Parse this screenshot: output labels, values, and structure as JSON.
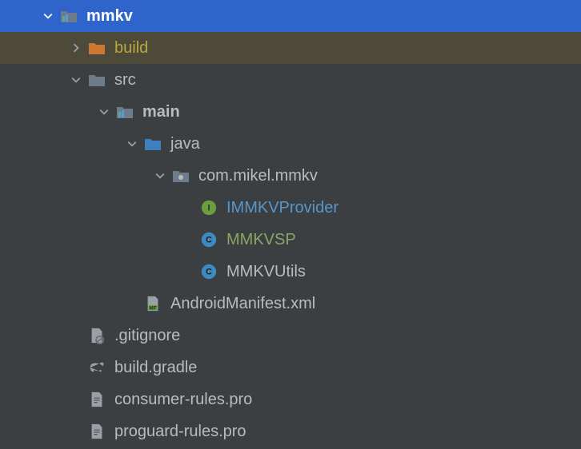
{
  "tree": {
    "mmkv": "mmkv",
    "build": "build",
    "src": "src",
    "main": "main",
    "java": "java",
    "package": "com.mikel.mmkv",
    "interface1": "IMMKVProvider",
    "class1": "MMKVSP",
    "class2": "MMKVUtils",
    "manifest": "AndroidManifest.xml",
    "gitignore": ".gitignore",
    "gradle": "build.gradle",
    "consumer": "consumer-rules.pro",
    "proguard": "proguard-rules.pro"
  },
  "badges": {
    "interface": "I",
    "class": "C",
    "manifest": "MF"
  }
}
